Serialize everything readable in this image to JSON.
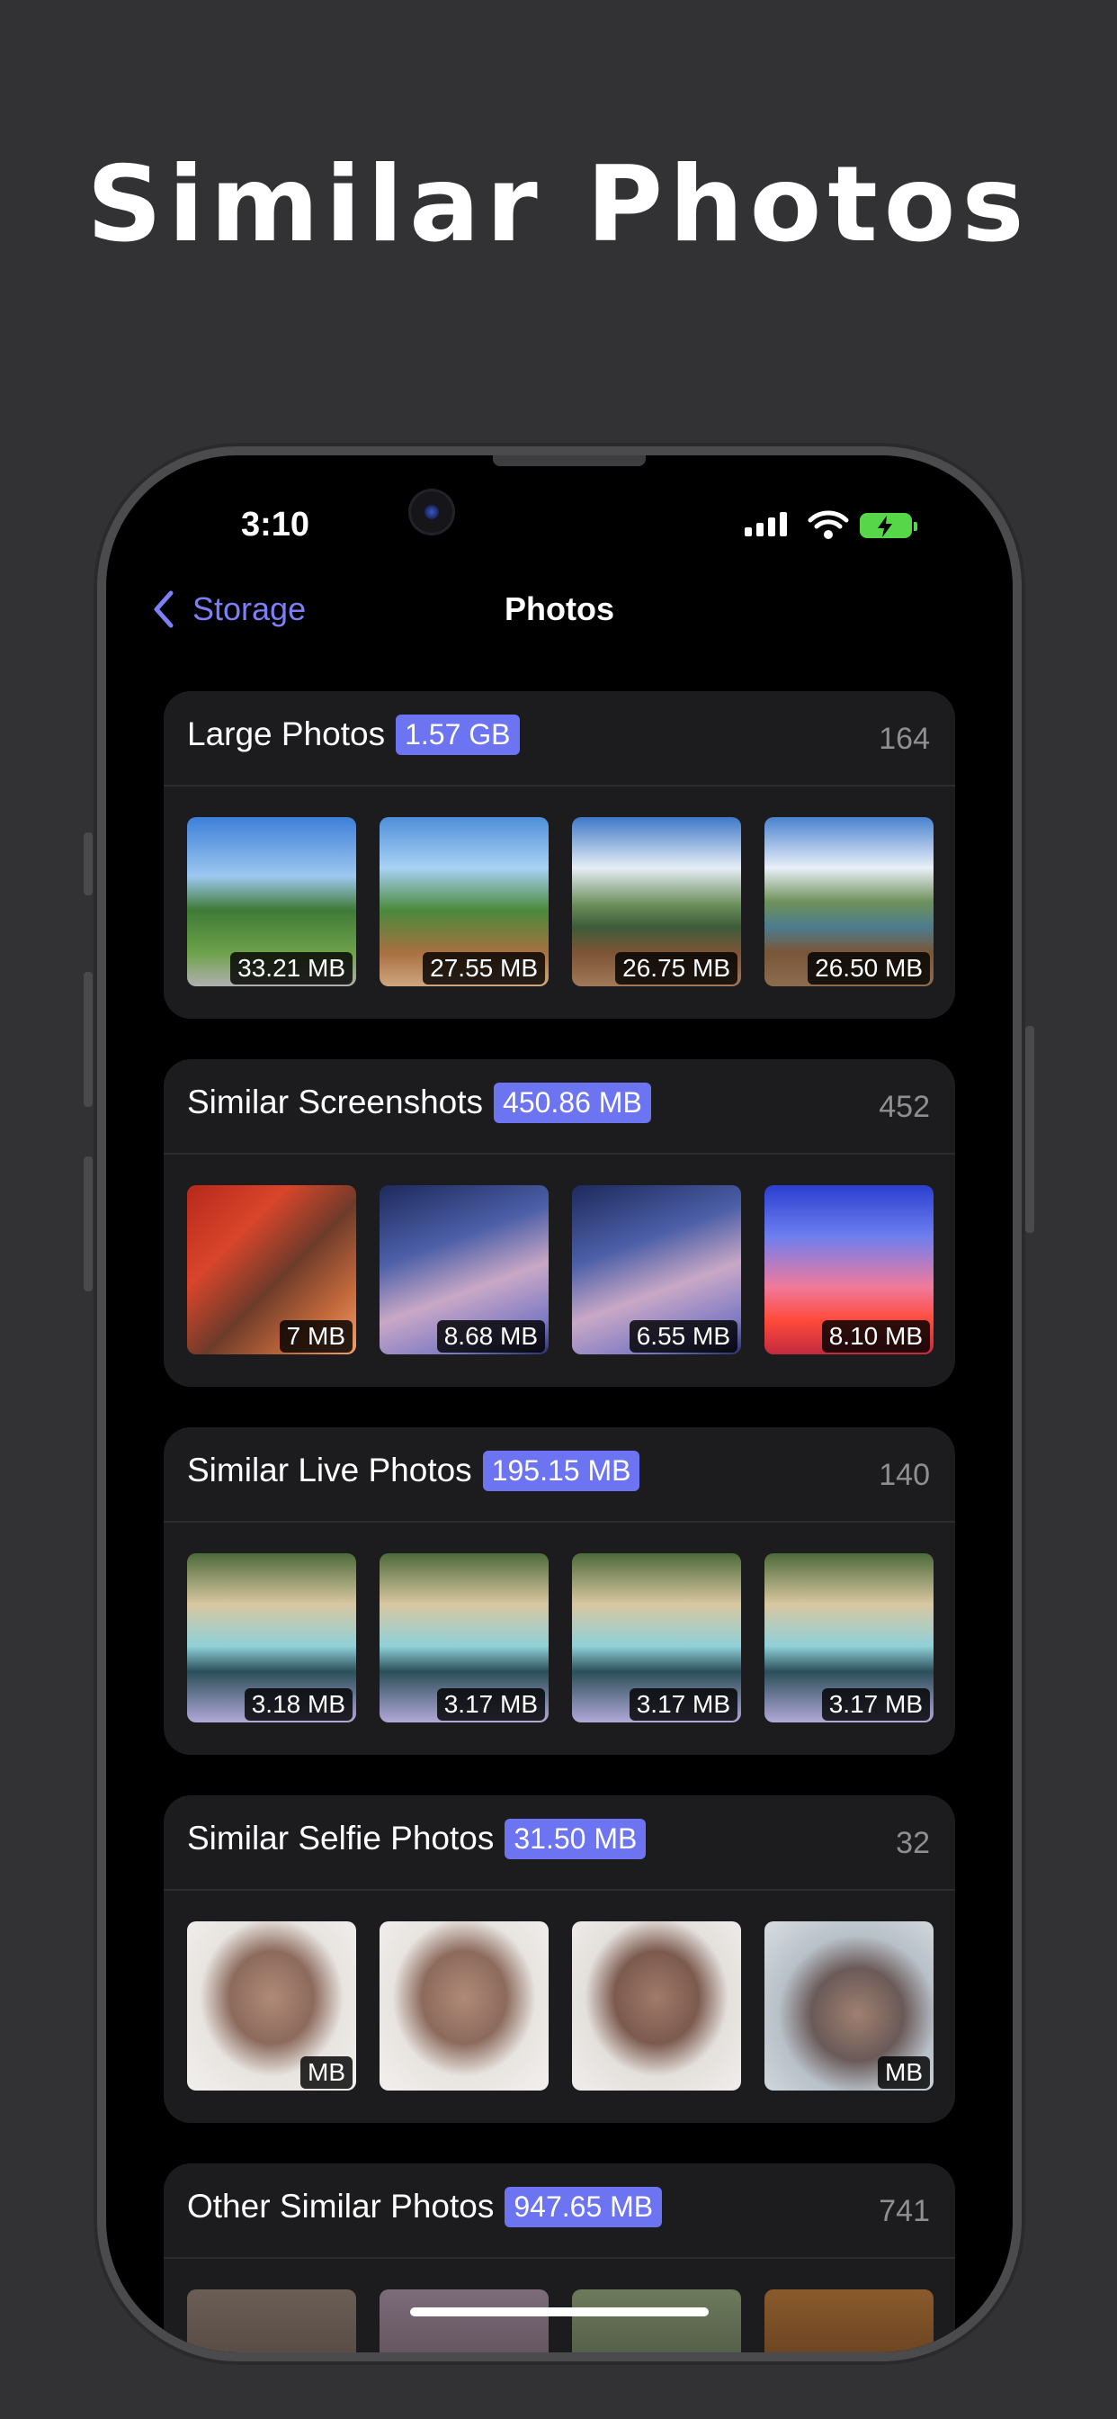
{
  "headline": "Similar Photos",
  "status": {
    "time": "3:10"
  },
  "nav": {
    "back_label": "Storage",
    "title": "Photos"
  },
  "colors": {
    "accent": "#6c74f2",
    "card_bg": "#1c1c1e",
    "battery": "#57d64a"
  },
  "cards": [
    {
      "title": "Large Photos",
      "size": "1.57 GB",
      "count": "164",
      "thumbs": [
        {
          "size": "33.21 MB",
          "style": "landscape-people"
        },
        {
          "size": "27.55 MB",
          "style": "landscape-people"
        },
        {
          "size": "26.75 MB",
          "style": "landscape-mountain"
        },
        {
          "size": "26.50 MB",
          "style": "landscape-mountain"
        }
      ]
    },
    {
      "title": "Similar Screenshots",
      "size": "450.86 MB",
      "count": "452",
      "thumbs": [
        {
          "size": "7 MB",
          "style": "red-portrait"
        },
        {
          "size": "8.68 MB",
          "style": "blue-portrait"
        },
        {
          "size": "6.55 MB",
          "style": "blue-portrait"
        },
        {
          "size": "8.10 MB",
          "style": "sunset"
        }
      ]
    },
    {
      "title": "Similar Live Photos",
      "size": "195.15 MB",
      "count": "140",
      "thumbs": [
        {
          "size": "3.18 MB",
          "style": "pixel-colorful"
        },
        {
          "size": "3.17 MB",
          "style": "pixel-colorful"
        },
        {
          "size": "3.17 MB",
          "style": "pixel-colorful"
        },
        {
          "size": "3.17 MB",
          "style": "pixel-colorful"
        }
      ]
    },
    {
      "title": "Similar Selfie Photos",
      "size": "31.50 MB",
      "count": "32",
      "thumbs": [
        {
          "size": "MB",
          "style": "pixel-face"
        },
        {
          "size": "",
          "style": "pixel-face"
        },
        {
          "size": "",
          "style": "pixel-face"
        },
        {
          "size": "MB",
          "style": "pixel-face"
        }
      ]
    },
    {
      "title": "Other Similar Photos",
      "size": "947.65 MB",
      "count": "741",
      "thumbs": [
        {
          "size": "",
          "style": "dark"
        },
        {
          "size": "",
          "style": "dark"
        },
        {
          "size": "",
          "style": "dark"
        },
        {
          "size": "",
          "style": "dark"
        }
      ]
    }
  ]
}
